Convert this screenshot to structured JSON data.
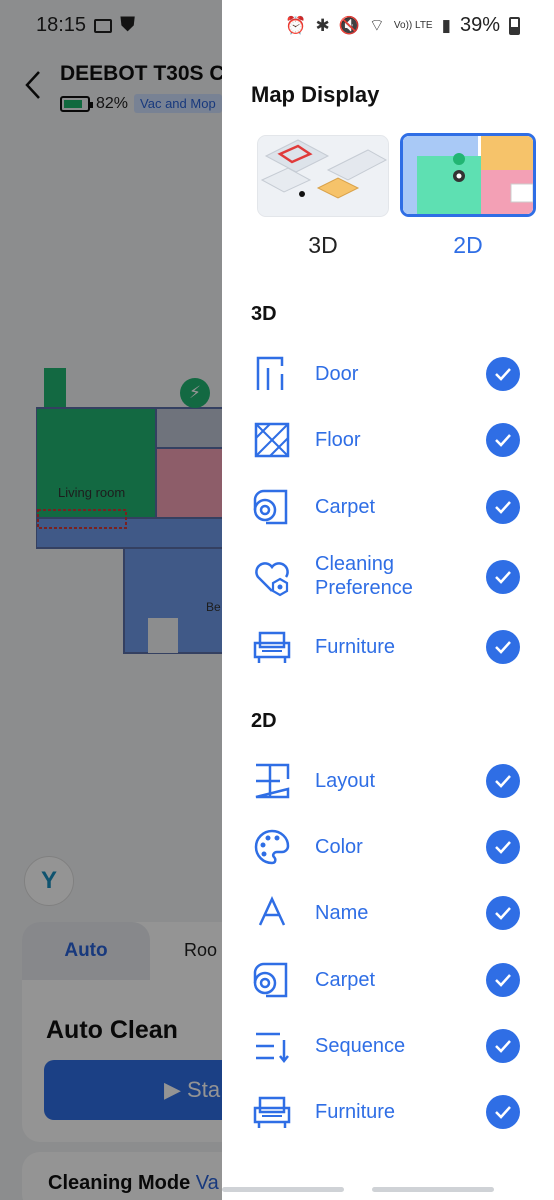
{
  "status_bar": {
    "time": "18:15",
    "battery_percent": "39%",
    "volte": "Vo)) LTE"
  },
  "background": {
    "device_title": "DEEBOT T30S C",
    "battery": "82%",
    "mode_badge": "Vac and Mop",
    "room_label": "Living room",
    "room_label_2": "Be",
    "tab_auto": "Auto",
    "tab_room": "Roo",
    "auto_clean_title": "Auto Clean",
    "start_button": "Sta",
    "cleaning_mode_label": "Cleaning Mode",
    "cleaning_mode_value": "Va"
  },
  "drawer": {
    "title": "Map Display",
    "view_options": [
      {
        "label": "3D",
        "selected": false
      },
      {
        "label": "2D",
        "selected": true
      }
    ],
    "sections": [
      {
        "heading": "3D",
        "items": [
          {
            "label": "Door",
            "icon": "door-icon",
            "checked": true
          },
          {
            "label": "Floor",
            "icon": "floor-icon",
            "checked": true
          },
          {
            "label": "Carpet",
            "icon": "carpet-icon",
            "checked": true
          },
          {
            "label": "Cleaning Preference",
            "icon": "cleaning-preference-icon",
            "checked": true
          },
          {
            "label": "Furniture",
            "icon": "furniture-icon",
            "checked": true
          }
        ]
      },
      {
        "heading": "2D",
        "items": [
          {
            "label": "Layout",
            "icon": "layout-icon",
            "checked": true
          },
          {
            "label": "Color",
            "icon": "palette-icon",
            "checked": true
          },
          {
            "label": "Name",
            "icon": "name-icon",
            "checked": true
          },
          {
            "label": "Carpet",
            "icon": "carpet-icon",
            "checked": true
          },
          {
            "label": "Sequence",
            "icon": "sequence-icon",
            "checked": true
          },
          {
            "label": "Furniture",
            "icon": "furniture-icon",
            "checked": true
          }
        ]
      }
    ]
  },
  "colors": {
    "accent": "#2f6ee5",
    "room_green": "#22b573",
    "room_pink": "#f3a0b5",
    "room_orange": "#f6c36a"
  }
}
